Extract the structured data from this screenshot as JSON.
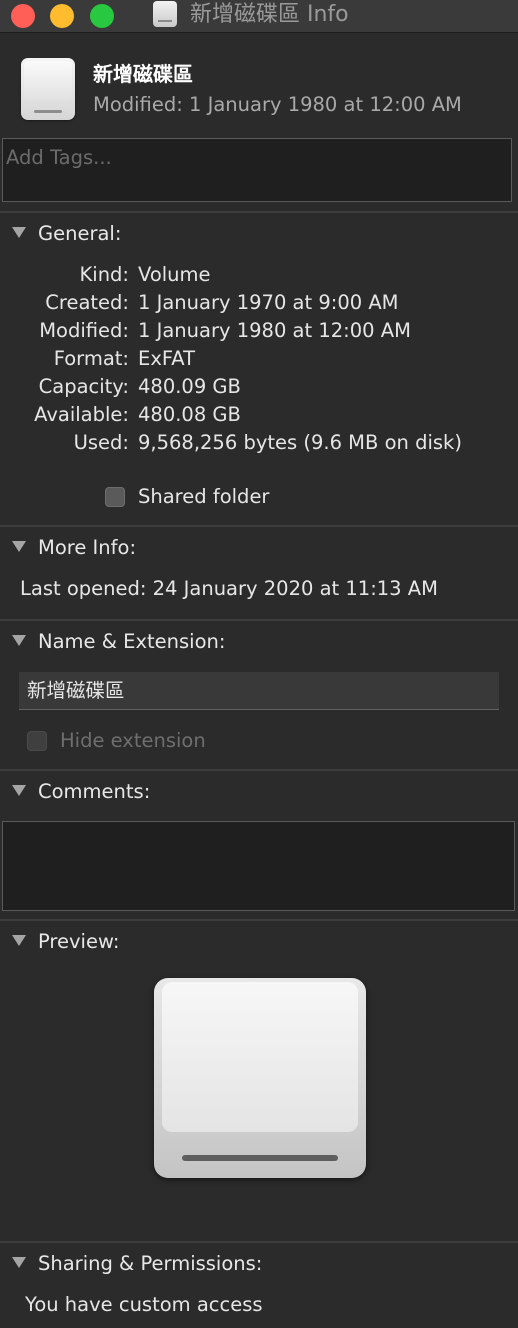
{
  "window": {
    "title": "新增磁碟區 Info"
  },
  "header": {
    "name": "新增磁碟區",
    "modified": "Modified: 1 January 1980 at 12:00 AM",
    "icon": "external-drive-icon"
  },
  "tags": {
    "placeholder": "Add Tags..."
  },
  "general": {
    "title": "General:",
    "rows": [
      {
        "label": "Kind:",
        "value": "Volume"
      },
      {
        "label": "Created:",
        "value": "1 January 1970 at 9:00 AM"
      },
      {
        "label": "Modified:",
        "value": "1 January 1980 at 12:00 AM"
      },
      {
        "label": "Format:",
        "value": "ExFAT"
      },
      {
        "label": "Capacity:",
        "value": "480.09 GB"
      },
      {
        "label": "Available:",
        "value": "480.08 GB"
      },
      {
        "label": "Used:",
        "value": "9,568,256 bytes (9.6 MB on disk)"
      }
    ],
    "shared_folder_label": "Shared folder"
  },
  "more_info": {
    "title": "More Info:",
    "last_opened": "Last opened: 24 January 2020 at 11:13 AM"
  },
  "name_extension": {
    "title": "Name & Extension:",
    "name_value": "新增磁碟區",
    "hide_extension_label": "Hide extension"
  },
  "comments": {
    "title": "Comments:"
  },
  "preview": {
    "title": "Preview:"
  },
  "sharing": {
    "title": "Sharing & Permissions:",
    "access": "You have custom access"
  }
}
